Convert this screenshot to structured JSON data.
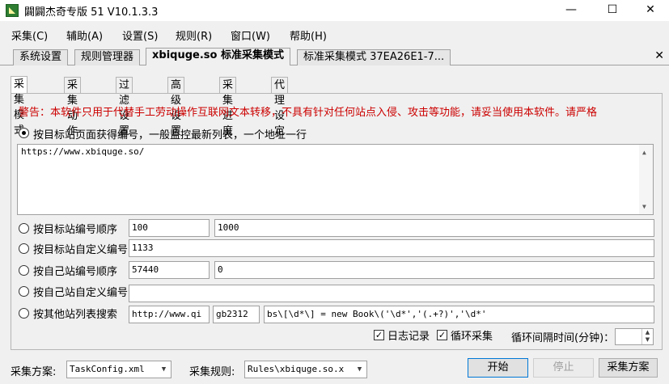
{
  "window": {
    "title": "闢闢杰奇专版 51 V10.1.3.3",
    "minimize": "—",
    "maximize": "☐",
    "close": "✕"
  },
  "menu": [
    "采集(C)",
    "辅助(A)",
    "设置(S)",
    "规则(R)",
    "窗口(W)",
    "帮助(H)"
  ],
  "doc_tabs": [
    "系统设置",
    "规则管理器",
    "xbiquge.so 标准采集模式",
    "标准采集模式 37EA26E1-7..."
  ],
  "doc_close": "✕",
  "sub_tabs": [
    "采集模式",
    "采集动作",
    "过滤设置",
    "高级设置",
    "采集进度",
    "代理设定"
  ],
  "warning": "警告：本软件只用于代替手工劳动操作互联网文本转移，不具有针对任何站点入侵、攻击等功能，请妥当使用本软件。请严格",
  "mode1": {
    "label": "按目标站页面获得编号，一般监控最新列表，一个地址一行",
    "urls": "https://www.xbiquge.so/"
  },
  "mode2": {
    "label": "按目标站编号顺序",
    "from": "100",
    "to": "1000"
  },
  "mode3": {
    "label": "按目标站自定义编号",
    "value": "1133"
  },
  "mode4": {
    "label": "按自己站编号顺序",
    "from": "57440",
    "to": "0"
  },
  "mode5": {
    "label": "按自己站自定义编号",
    "value": ""
  },
  "mode6": {
    "label": "按其他站列表搜索",
    "url": "http://www.qi",
    "encoding": "gb2312",
    "regex": "bs\\[\\d*\\] = new Book\\('\\d*','(.+?)','\\d*'"
  },
  "options": {
    "log_label": "日志记录",
    "loop_label": "循环采集",
    "interval_label": "循环间隔时间(分钟)：",
    "interval_value": ""
  },
  "bottom": {
    "plan_label": "采集方案:",
    "plan_value": "TaskConfig.xml",
    "rule_label": "采集规则:",
    "rule_value": "Rules\\xbiquge.so.x",
    "start_button": "开始",
    "stop_button": "停止",
    "plan_button": "采集方案"
  }
}
